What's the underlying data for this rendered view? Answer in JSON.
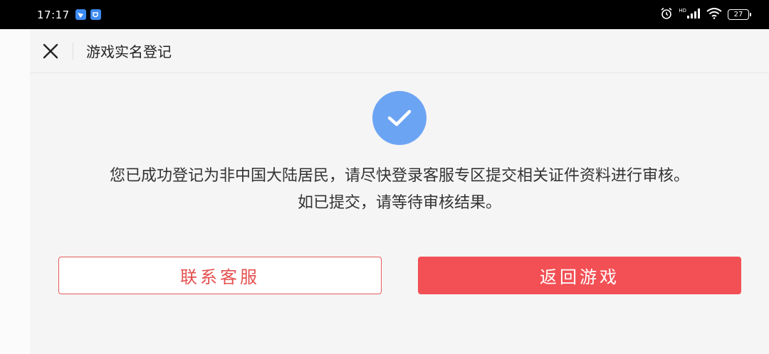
{
  "status_bar": {
    "time": "17:17",
    "signal_label": "HD",
    "battery_level": "27"
  },
  "nav": {
    "title": "游戏实名登记"
  },
  "message": {
    "line1": "您已成功登记为非中国大陆居民，请尽快登录客服专区提交相关证件资料进行审核。",
    "line2": "如已提交，请等待审核结果。"
  },
  "buttons": {
    "contact_label": "联系客服",
    "return_label": "返回游戏"
  },
  "colors": {
    "accent": "#f25055",
    "success": "#6ca4f4"
  }
}
